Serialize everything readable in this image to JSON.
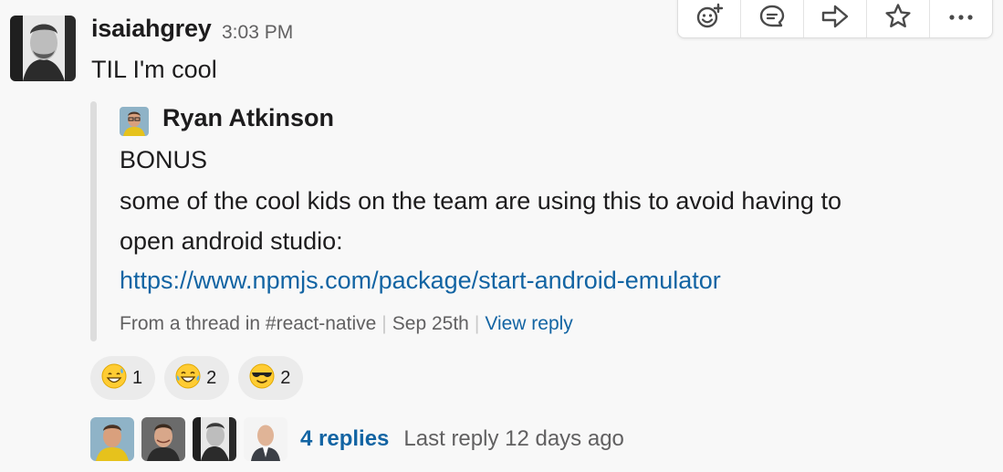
{
  "message": {
    "sender": "isaiahgrey",
    "time": "3:03 PM",
    "text": "TIL I'm cool"
  },
  "actions": [
    {
      "icon": "add-reaction-icon"
    },
    {
      "icon": "reply-thread-icon"
    },
    {
      "icon": "share-message-icon"
    },
    {
      "icon": "star-icon"
    },
    {
      "icon": "more-actions-icon"
    }
  ],
  "quote": {
    "author": "Ryan Atkinson",
    "lines": [
      "BONUS",
      "some of the cool kids on the team are using this to avoid having to",
      "open android studio:"
    ],
    "link": "https://www.npmjs.com/package/start-android-emulator",
    "meta": {
      "source": "From a thread in #react-native",
      "date": "Sep 25th",
      "view": "View reply"
    }
  },
  "reactions": [
    {
      "emoji": "grinning-sweat-emoji",
      "count": "1"
    },
    {
      "emoji": "tears-of-joy-emoji",
      "count": "2"
    },
    {
      "emoji": "sunglasses-emoji",
      "count": "2"
    }
  ],
  "thread": {
    "reply_count": "4 replies",
    "last_reply": "Last reply 12 days ago"
  },
  "colors": {
    "link": "#1264a3",
    "text": "#1d1c1d",
    "muted": "#616061",
    "background": "#f8f8f8"
  }
}
